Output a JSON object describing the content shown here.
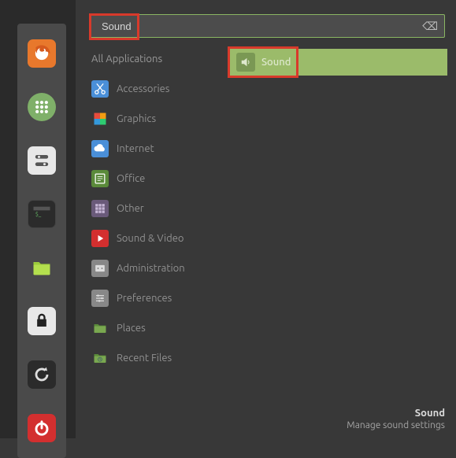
{
  "search": {
    "value": "Sound"
  },
  "categories": {
    "all": "All Applications",
    "items": [
      {
        "label": "Accessories"
      },
      {
        "label": "Graphics"
      },
      {
        "label": "Internet"
      },
      {
        "label": "Office"
      },
      {
        "label": "Other"
      },
      {
        "label": "Sound & Video"
      },
      {
        "label": "Administration"
      },
      {
        "label": "Preferences"
      },
      {
        "label": "Places"
      },
      {
        "label": "Recent Files"
      }
    ]
  },
  "result": {
    "label": "Sound"
  },
  "footer": {
    "title": "Sound",
    "description": "Manage sound settings"
  }
}
